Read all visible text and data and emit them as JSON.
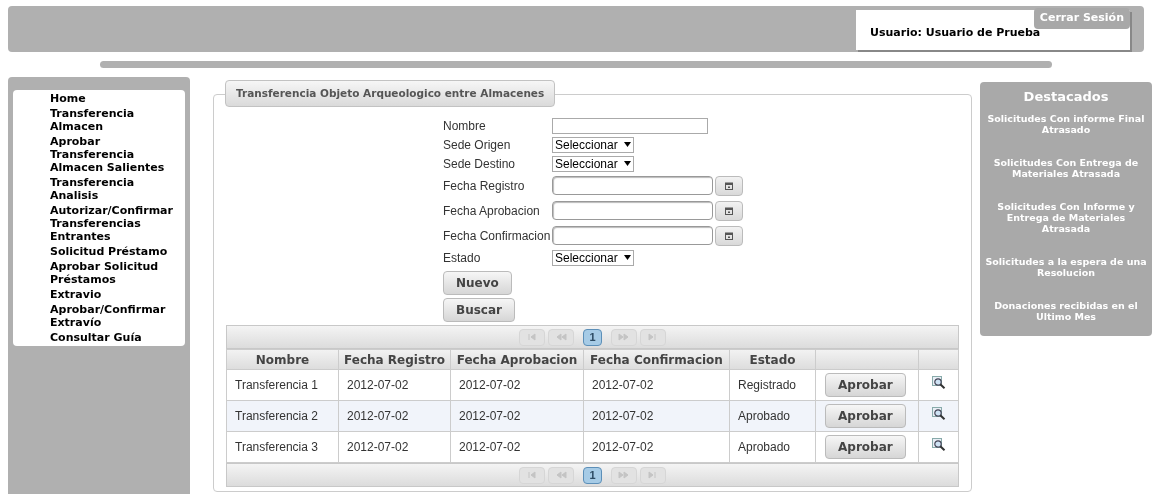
{
  "header": {
    "user_label": "Usuario: Usuario de Prueba",
    "logout": "Cerrar Sesión"
  },
  "sidebar": {
    "items": [
      {
        "label": "Home"
      },
      {
        "label": "Transferencia Almacen"
      },
      {
        "label": "Aprobar Transferencia Almacen Salientes"
      },
      {
        "label": "Transferencia Analisis"
      },
      {
        "label": "Autorizar/Confirmar Transferencias Entrantes"
      },
      {
        "label": "Solicitud Préstamo"
      },
      {
        "label": "Aprobar Solicitud Préstamos"
      },
      {
        "label": "Extravio"
      },
      {
        "label": "Aprobar/Confirmar Extravío"
      },
      {
        "label": "Consultar Guía"
      }
    ]
  },
  "panel": {
    "title": "Transferencia Objeto Arqueologico entre Almacenes",
    "form": [
      {
        "kind": "text",
        "label": "Nombre"
      },
      {
        "kind": "select",
        "label": "Sede Origen",
        "value": "Seleccionar"
      },
      {
        "kind": "select",
        "label": "Sede Destino",
        "value": "Seleccionar"
      },
      {
        "kind": "date",
        "label": "Fecha Registro"
      },
      {
        "kind": "date",
        "label": "Fecha Aprobacion"
      },
      {
        "kind": "date",
        "label": "Fecha Confirmacion"
      },
      {
        "kind": "select",
        "label": "Estado",
        "value": "Seleccionar"
      }
    ],
    "buttons": [
      "Nuevo",
      "Buscar"
    ],
    "pager_top": {
      "pages": [
        {
          "label": "1",
          "selected": true
        }
      ]
    },
    "table": {
      "columns": [
        "Nombre",
        "Fecha Registro",
        "Fecha Aprobacion",
        "Fecha Confirmacion",
        "Estado"
      ],
      "rows": [
        {
          "cells": [
            "Transferencia 1",
            "2012-07-02",
            "2012-07-02",
            "2012-07-02",
            "Registrado"
          ],
          "action": "Aprobar"
        },
        {
          "cells": [
            "Transferencia 2",
            "2012-07-02",
            "2012-07-02",
            "2012-07-02",
            "Aprobado"
          ],
          "action": "Aprobar"
        },
        {
          "cells": [
            "Transferencia 3",
            "2012-07-02",
            "2012-07-02",
            "2012-07-02",
            "Aprobado"
          ],
          "action": "Aprobar"
        }
      ]
    },
    "pager_bottom": {
      "pages": [
        {
          "label": "1",
          "selected": true
        }
      ]
    }
  },
  "highlights": {
    "title": "Destacados",
    "items": [
      "Solicitudes Con informe Final Atrasado",
      "Solicitudes Con Entrega de Materiales Atrasada",
      "Solicitudes Con Informe y Entrega de Materiales Atrasada",
      "Solicitudes a la espera de una Resolucion",
      "Donaciones recibidas en el Ultimo Mes"
    ]
  }
}
